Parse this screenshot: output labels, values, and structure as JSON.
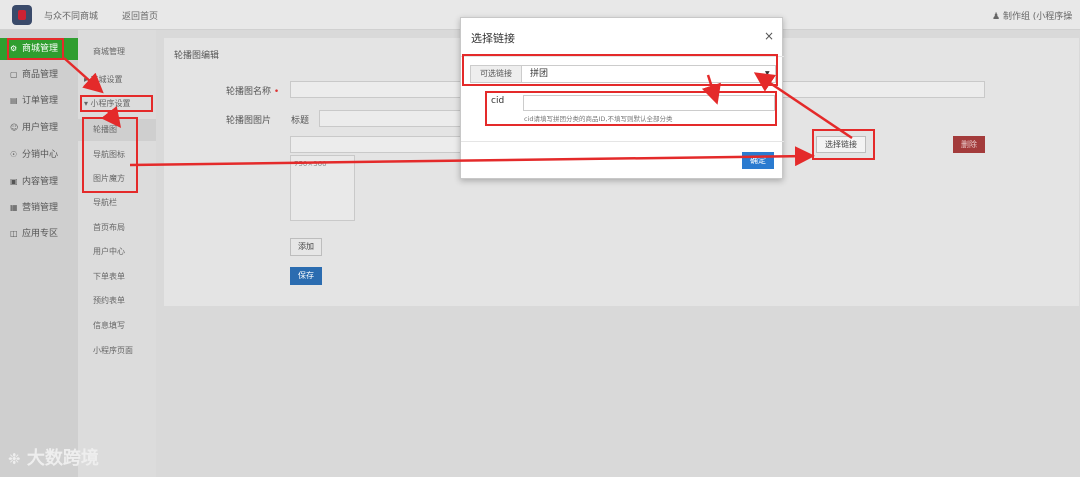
{
  "header": {
    "app_title": "与众不同商城",
    "home_link": "返回首页",
    "user_text": "制作组 (小程序操"
  },
  "sidebar": {
    "items": [
      {
        "label": "商城管理",
        "icon": "gear-icon"
      },
      {
        "label": "商品管理",
        "icon": "box-icon"
      },
      {
        "label": "订单管理",
        "icon": "list-icon"
      },
      {
        "label": "用户管理",
        "icon": "user-icon"
      },
      {
        "label": "分销中心",
        "icon": "share-icon"
      },
      {
        "label": "内容管理",
        "icon": "document-icon"
      },
      {
        "label": "营销管理",
        "icon": "chart-icon"
      },
      {
        "label": "应用专区",
        "icon": "apps-icon"
      }
    ]
  },
  "submenu": {
    "items": [
      "商城管理",
      "▸ 商城设置",
      "▾ 小程序设置",
      "轮播图",
      "导航图标",
      "图片魔方",
      "导航栏",
      "首页布局",
      "用户中心",
      "下单表单",
      "预约表单",
      "信息填写",
      "小程序页面"
    ]
  },
  "content": {
    "title": "轮播图编辑",
    "name_label": "轮播图名称",
    "image_label": "轮播图图片",
    "title_label": "标题",
    "size_hint": "750×360",
    "select_link_button": "选择链接",
    "delete_button": "删除",
    "add_button": "添加",
    "save_button": "保存"
  },
  "modal": {
    "title": "选择链接",
    "close": "×",
    "addon_label": "可选链接",
    "select_value": "拼团",
    "cid_label": "cid",
    "cid_value": "",
    "cid_help": "cid请填写拼团分类的商品ID,不填写则默认全部分类",
    "confirm_button": "确定"
  },
  "watermark": "大数跨境",
  "colors": {
    "sidebar_active": "#2f9e2f",
    "annotation": "#e42a2a",
    "primary": "#2b7bd0",
    "danger": "#a33b3b"
  }
}
